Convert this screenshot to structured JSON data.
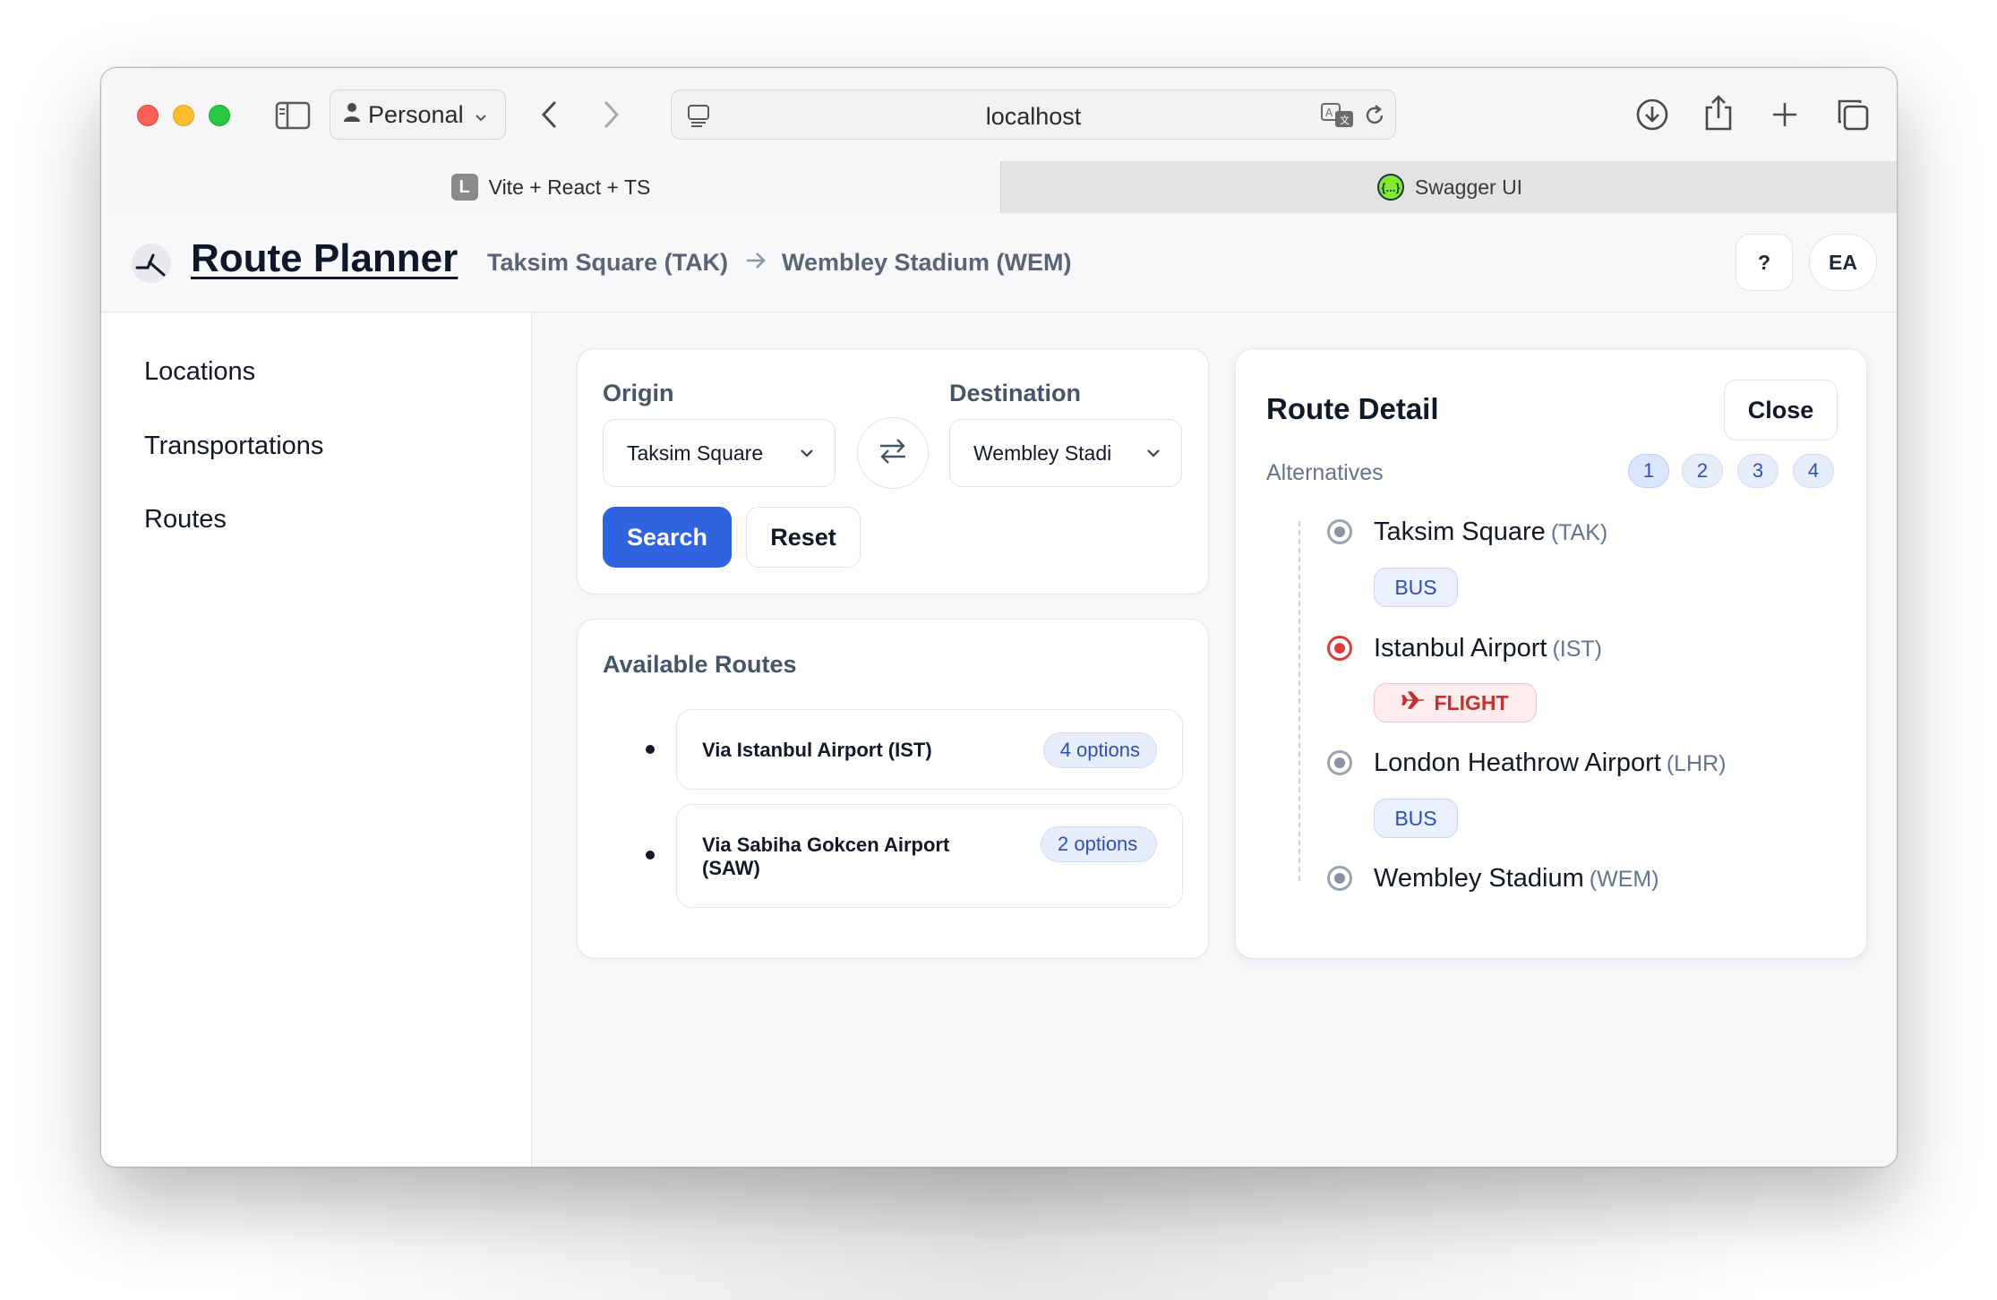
{
  "browser": {
    "profile_label": "Personal",
    "url": "localhost",
    "tabs": [
      {
        "label": "Vite + React + TS",
        "favicon": "L",
        "active": true
      },
      {
        "label": "Swagger UI",
        "favicon": "{...}",
        "active": false
      }
    ]
  },
  "header": {
    "title": "Route Planner",
    "breadcrumb_origin": "Taksim Square (TAK)",
    "breadcrumb_dest": "Wembley Stadium (WEM)",
    "help_label": "?",
    "avatar_initials": "EA"
  },
  "sidebar": {
    "items": [
      {
        "label": "Locations"
      },
      {
        "label": "Transportations"
      },
      {
        "label": "Routes"
      }
    ]
  },
  "search": {
    "origin_label": "Origin",
    "origin_value": "Taksim Square",
    "destination_label": "Destination",
    "destination_value": "Wembley Stadi",
    "search_label": "Search",
    "reset_label": "Reset"
  },
  "routes": {
    "title": "Available Routes",
    "items": [
      {
        "name": "Via Istanbul Airport (IST)",
        "options": "4 options"
      },
      {
        "name": "Via Sabiha Gokcen Airport (SAW)",
        "options": "2 options"
      }
    ]
  },
  "detail": {
    "title": "Route Detail",
    "close_label": "Close",
    "alternatives_label": "Alternatives",
    "alternatives": [
      "1",
      "2",
      "3",
      "4"
    ],
    "selected_alternative": "1",
    "stops": [
      {
        "name": "Taksim Square",
        "code": "(TAK)",
        "active": false
      },
      {
        "name": "Istanbul Airport",
        "code": "(IST)",
        "active": true
      },
      {
        "name": "London Heathrow Airport",
        "code": "(LHR)",
        "active": false
      },
      {
        "name": "Wembley Stadium",
        "code": "(WEM)",
        "active": false
      }
    ],
    "segments": [
      {
        "mode": "BUS"
      },
      {
        "mode": "FLIGHT"
      },
      {
        "mode": "BUS"
      }
    ]
  },
  "colors": {
    "primary": "#2f63e0",
    "flight": "#c23030",
    "bus": "#2f4fb4"
  }
}
